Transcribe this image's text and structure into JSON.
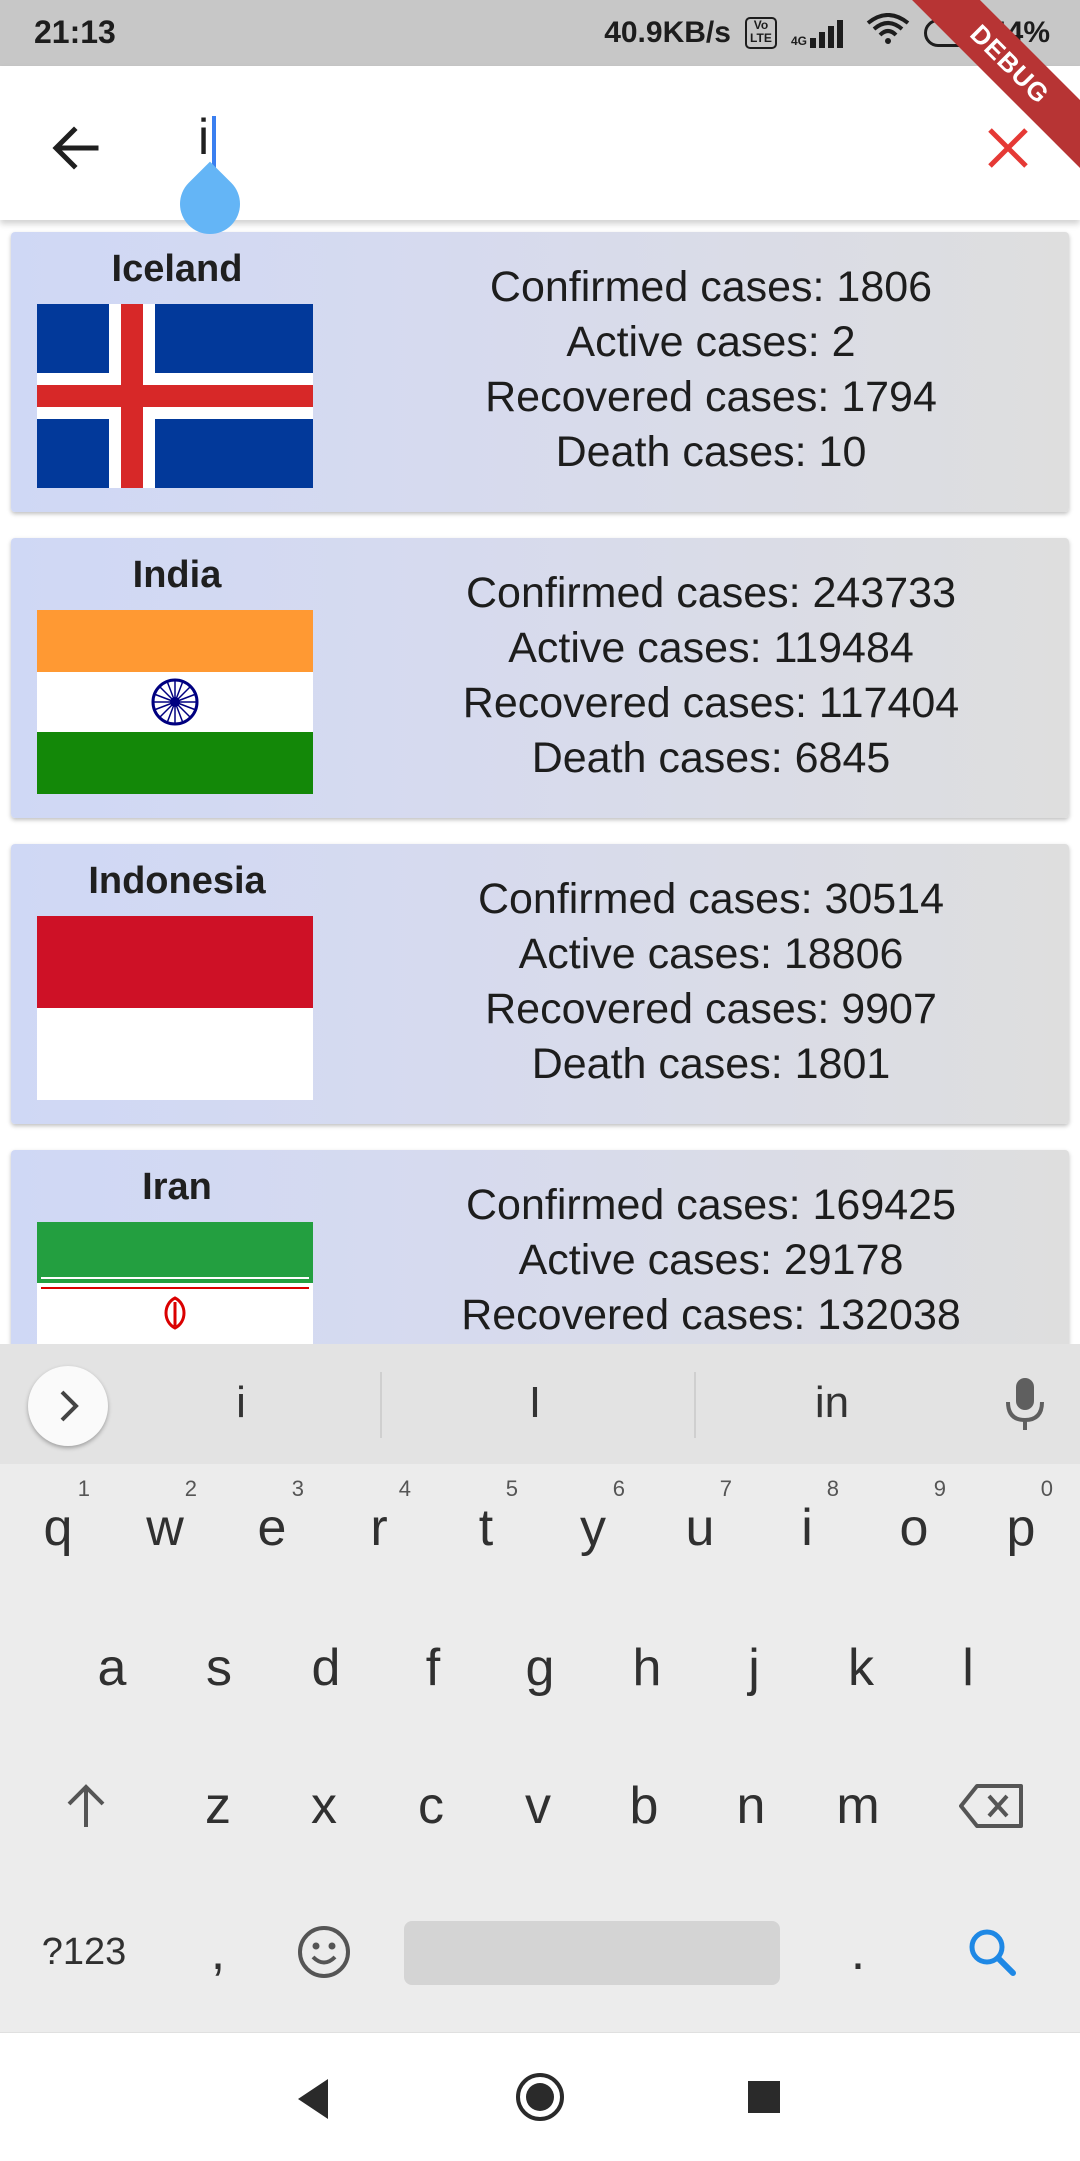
{
  "status_bar": {
    "time": "21:13",
    "network_speed": "40.9KB/s",
    "volte": "Vo LTE",
    "signal": "4G",
    "battery": "44%",
    "debug_banner": "DEBUG"
  },
  "search": {
    "query": "i"
  },
  "countries": [
    {
      "name": "Iceland",
      "stats": [
        "Confirmed cases: 1806",
        "Active cases: 2",
        "Recovered cases: 1794",
        "Death cases: 10"
      ]
    },
    {
      "name": "India",
      "stats": [
        "Confirmed cases: 243733",
        "Active cases: 119484",
        "Recovered cases: 117404",
        "Death cases: 6845"
      ]
    },
    {
      "name": "Indonesia",
      "stats": [
        "Confirmed cases: 30514",
        "Active cases: 18806",
        "Recovered cases: 9907",
        "Death cases: 1801"
      ]
    },
    {
      "name": "Iran",
      "stats": [
        "Confirmed cases: 169425",
        "Active cases: 29178",
        "Recovered cases: 132038"
      ]
    }
  ],
  "keyboard": {
    "suggestions": [
      "i",
      "I",
      "in"
    ],
    "row1": [
      "q",
      "w",
      "e",
      "r",
      "t",
      "y",
      "u",
      "i",
      "o",
      "p"
    ],
    "row1_numbers": [
      "1",
      "2",
      "3",
      "4",
      "5",
      "6",
      "7",
      "8",
      "9",
      "0"
    ],
    "row2": [
      "a",
      "s",
      "d",
      "f",
      "g",
      "h",
      "j",
      "k",
      "l"
    ],
    "row3": [
      "z",
      "x",
      "c",
      "v",
      "b",
      "n",
      "m"
    ],
    "symbols_key": "?123",
    "comma": ",",
    "period": "."
  },
  "colors": {
    "accent_close": "#e53935",
    "cursor_handle": "#64b5f6",
    "search_key": "#1e88e5"
  }
}
